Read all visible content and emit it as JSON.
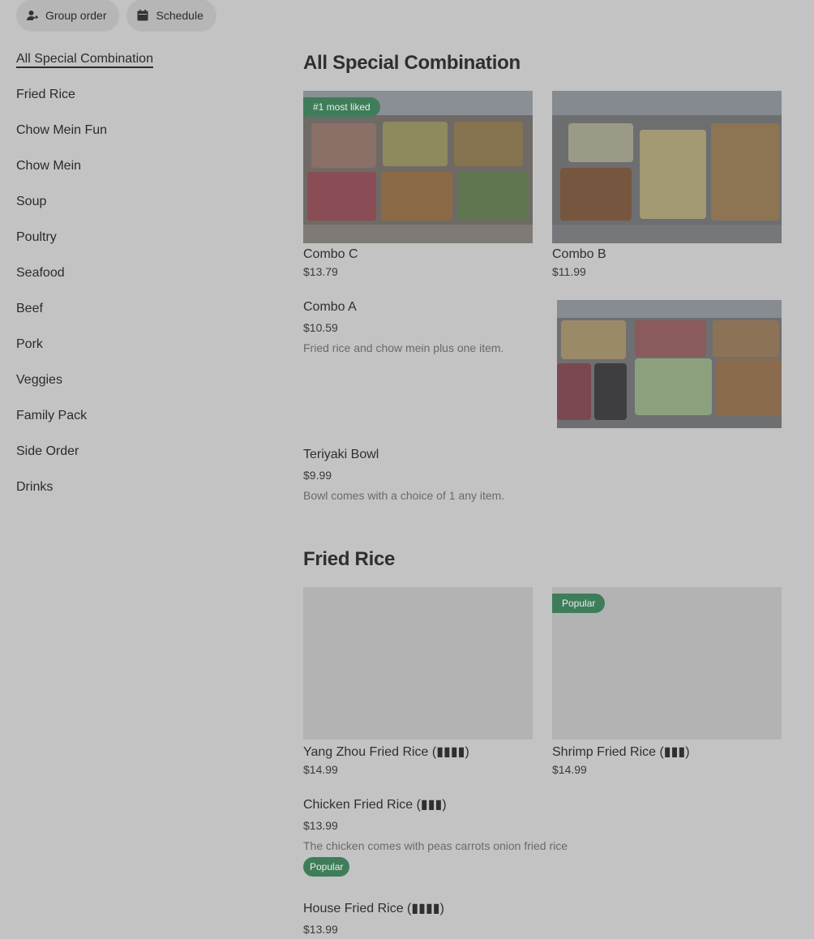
{
  "topbar": {
    "group_order_label": "Group order",
    "schedule_label": "Schedule"
  },
  "sidebar": {
    "items": [
      {
        "label": "All Special Combination",
        "active": true
      },
      {
        "label": "Fried Rice"
      },
      {
        "label": "Chow Mein Fun"
      },
      {
        "label": "Chow Mein"
      },
      {
        "label": "Soup"
      },
      {
        "label": "Poultry"
      },
      {
        "label": "Seafood"
      },
      {
        "label": "Beef"
      },
      {
        "label": "Pork"
      },
      {
        "label": "Veggies"
      },
      {
        "label": "Family Pack"
      },
      {
        "label": "Side Order"
      },
      {
        "label": "Drinks"
      }
    ]
  },
  "sections": {
    "combo": {
      "title": "All Special Combination",
      "combo_c": {
        "name": "Combo C",
        "price": "$13.79",
        "badge": "#1 most liked"
      },
      "combo_b": {
        "name": "Combo B",
        "price": "$11.99"
      },
      "combo_a": {
        "name": "Combo A",
        "price": "$10.59",
        "description": "Fried rice and chow mein plus one item."
      },
      "teriyaki": {
        "name": "Teriyaki Bowl",
        "price": "$9.99",
        "description": "Bowl comes with a choice of 1 any item."
      }
    },
    "fried_rice": {
      "title": "Fried Rice",
      "yang_zhou": {
        "name": "Yang Zhou Fried Rice (▮▮▮▮)",
        "price": "$14.99"
      },
      "shrimp": {
        "name": "Shrimp Fried Rice (▮▮▮)",
        "price": "$14.99",
        "badge": "Popular"
      },
      "chicken": {
        "name": "Chicken Fried Rice (▮▮▮)",
        "price": "$13.99",
        "description": "The chicken comes with peas carrots onion fried rice",
        "badge": "Popular"
      },
      "house": {
        "name": "House Fried Rice (▮▮▮▮)",
        "price": "$13.99"
      }
    }
  },
  "colors": {
    "background": "#c3c3c3",
    "badge": "#3f7d5a",
    "placeholder": "#b3b3b3"
  }
}
